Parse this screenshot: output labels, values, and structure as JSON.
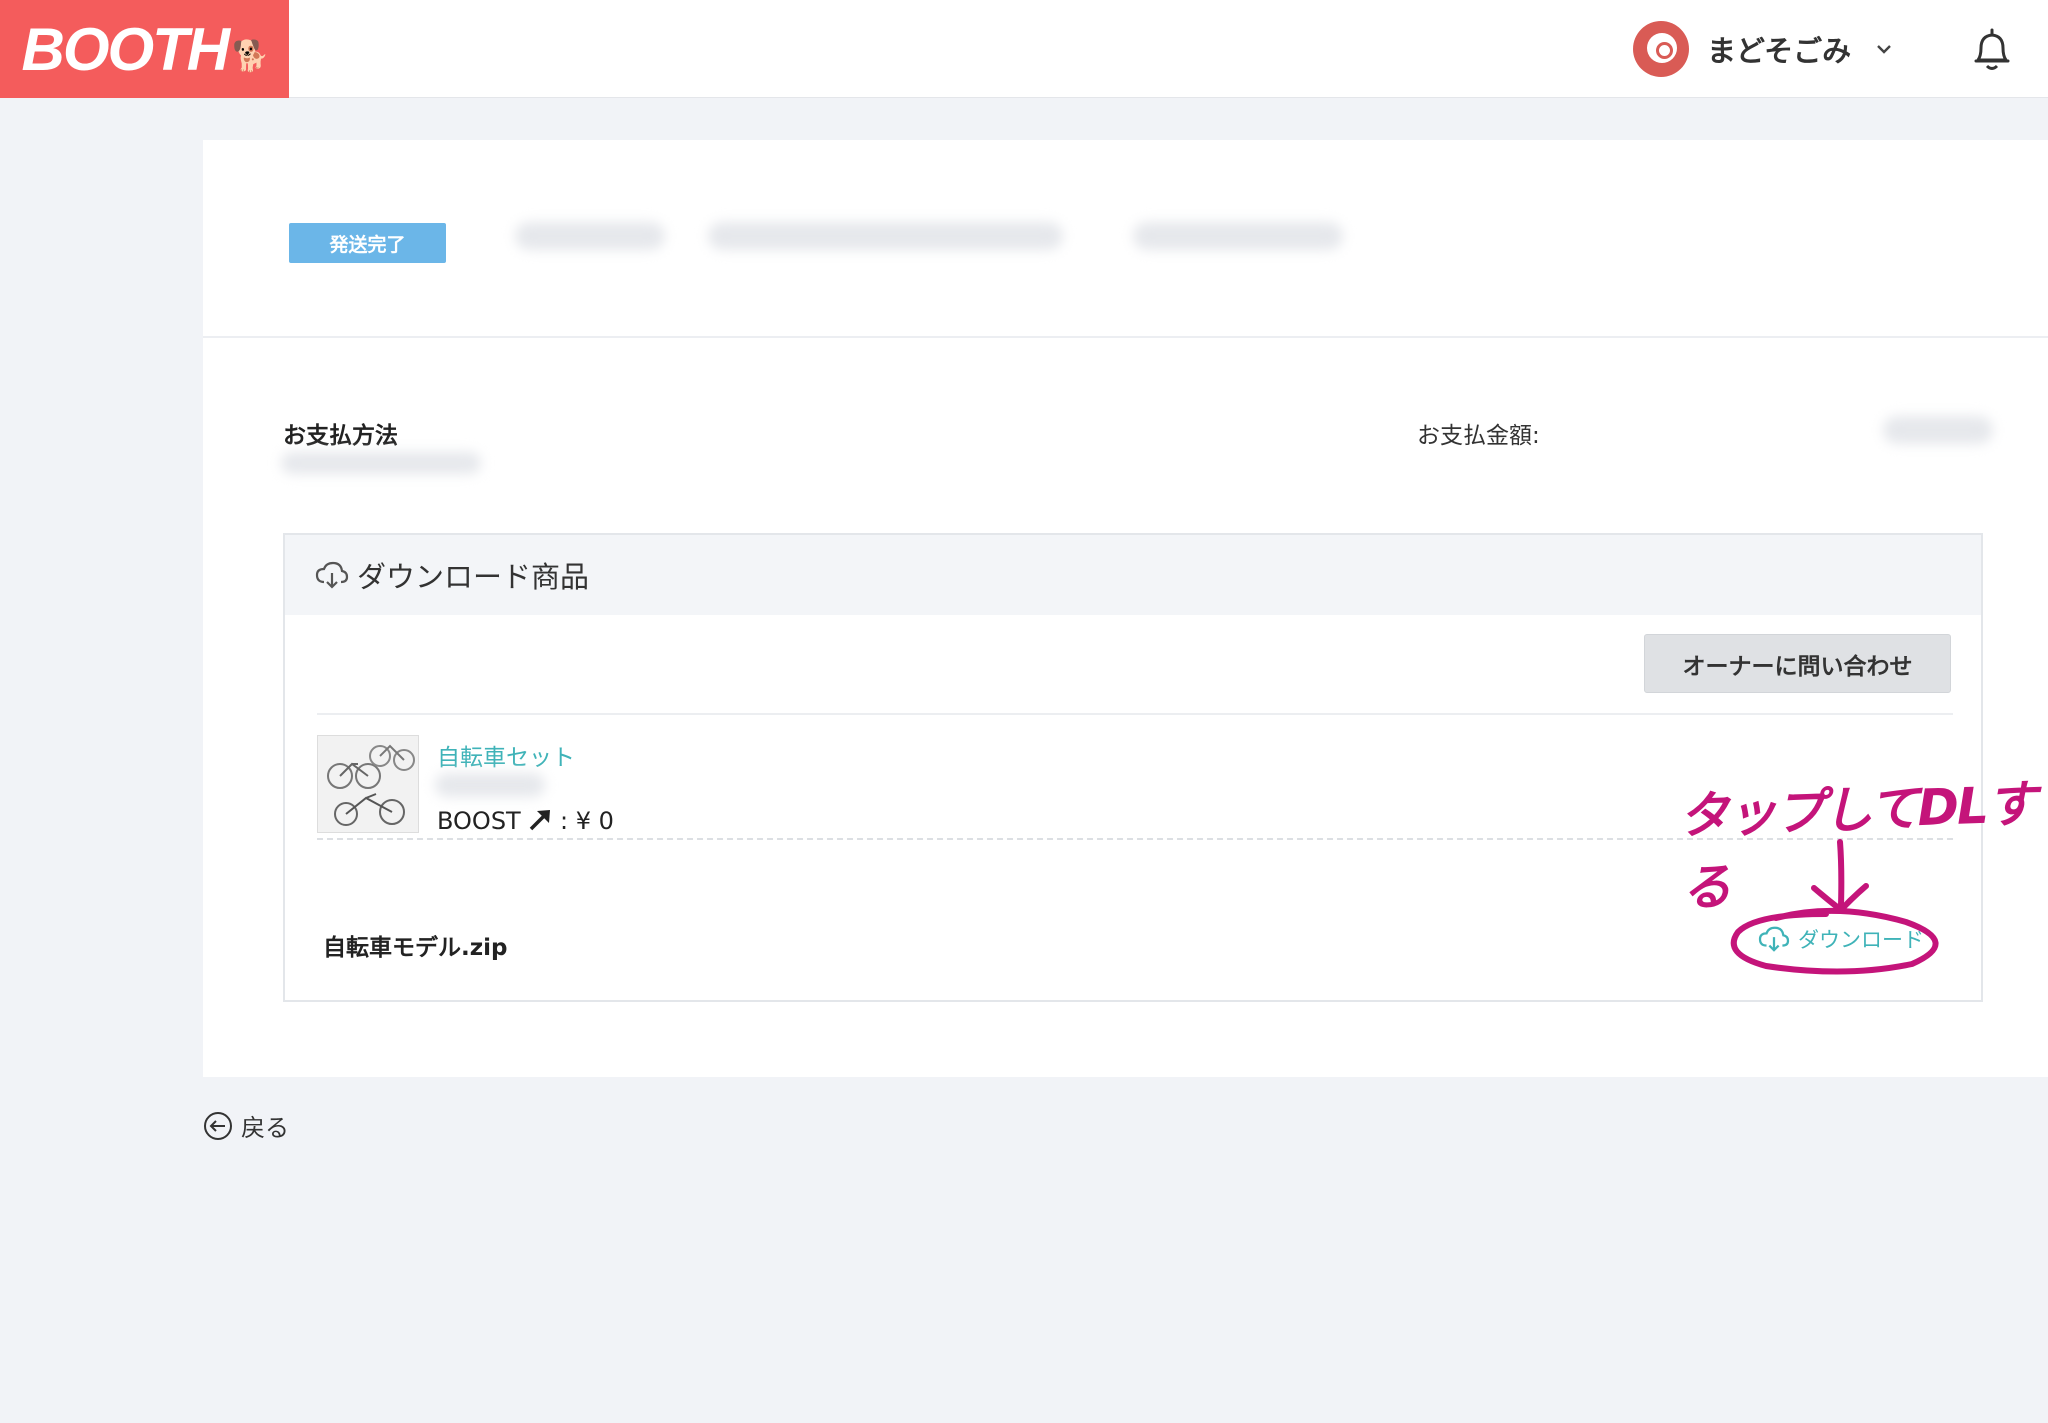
{
  "header": {
    "logo_text": "BOOTH",
    "user_name": "まどそごみ"
  },
  "order": {
    "status_badge": "発送完了",
    "payment_method_label": "お支払方法",
    "payment_amount_label": "お支払金額:"
  },
  "downloads": {
    "section_title": "ダウンロード商品",
    "contact_button": "オーナーに問い合わせ",
    "item": {
      "name": "自転車セット",
      "boost_text": "BOOST",
      "price_text": ": ¥ 0"
    },
    "file": {
      "name": "自転車モデル.zip",
      "download_label": "ダウンロード"
    }
  },
  "annotation": {
    "text": "タップしてDLする",
    "color": "#c4147a"
  },
  "back_link": "戻る",
  "colors": {
    "brand": "#f45c5c",
    "badge": "#6bb6e8",
    "link": "#3fb3b8"
  }
}
